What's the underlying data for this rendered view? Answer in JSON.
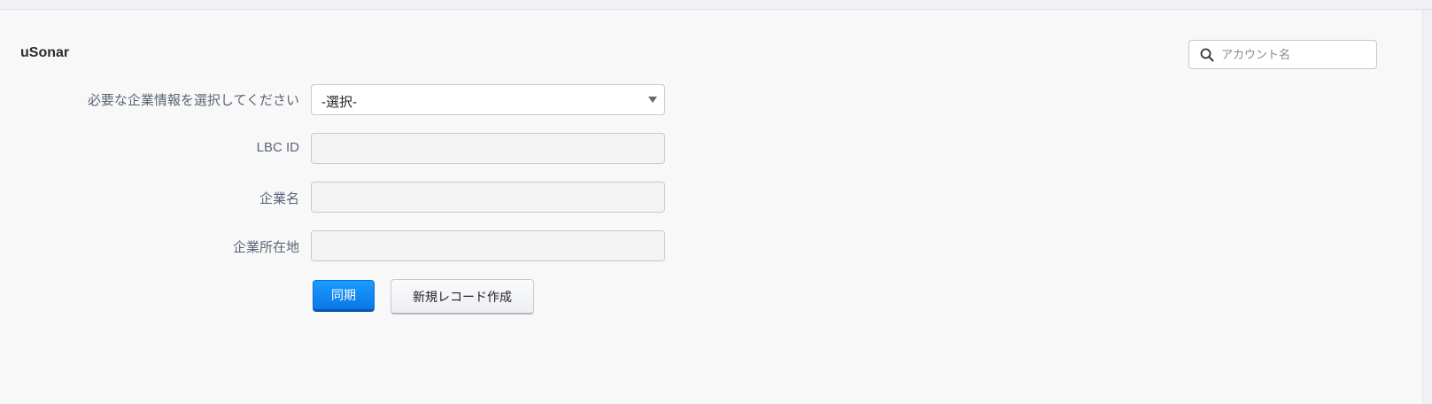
{
  "app": {
    "title": "uSonar"
  },
  "search": {
    "placeholder": "アカウント名",
    "value": ""
  },
  "form": {
    "company_info_label": "必要な企業情報を選択してください",
    "company_info_selected": "-選択-",
    "lbc_id_label": "LBC ID",
    "lbc_id_value": "",
    "company_name_label": "企業名",
    "company_name_value": "",
    "company_address_label": "企業所在地",
    "company_address_value": ""
  },
  "buttons": {
    "sync_label": "同期",
    "new_record_label": "新規レコード作成"
  },
  "colors": {
    "primary_button": "#0a78e6",
    "background": "#f8f8f8",
    "label_text": "#5a6476"
  }
}
